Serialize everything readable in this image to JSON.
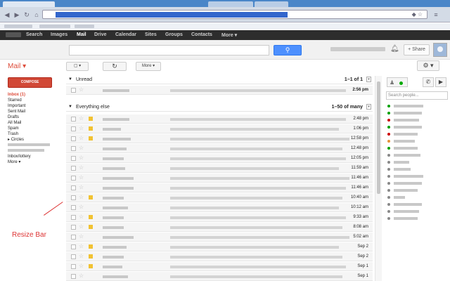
{
  "google_bar": {
    "items": [
      "Search",
      "Images",
      "Mail",
      "Drive",
      "Calendar",
      "Sites",
      "Groups",
      "Contacts",
      "More ▾"
    ]
  },
  "header": {
    "search_placeholder": "",
    "share_label": "+ Share"
  },
  "mail": {
    "title": "Mail ▾",
    "compose_label": "COMPOSE",
    "more_label": "More ▾",
    "refresh_icon": "↻",
    "settings_icon": "⚙ ▾"
  },
  "sidebar": {
    "items": [
      "Inbox (1)",
      "Starred",
      "Important",
      "Sent Mail",
      "Drafts",
      "All Mail",
      "Spam",
      "Trash"
    ],
    "circles_label": "Circles",
    "extra_item": "Inbox/lottery",
    "more_label": "More ▾"
  },
  "annotation": {
    "label": "Resize Bar"
  },
  "sections": {
    "unread": {
      "title": "Unread",
      "paging": "1–1 of 1"
    },
    "everything": {
      "title": "Everything else",
      "paging_prefix": "1–50 of",
      "paging_suffix": "many"
    }
  },
  "unread_rows": [
    {
      "date": "2:56 pm",
      "important": false
    }
  ],
  "rows": [
    {
      "date": "2:48 pm",
      "important": true
    },
    {
      "date": "1:06 pm",
      "important": true
    },
    {
      "date": "12:58 pm",
      "important": true
    },
    {
      "date": "12:48 pm",
      "important": false
    },
    {
      "date": "12:05 pm",
      "important": false
    },
    {
      "date": "11:59 am",
      "important": false
    },
    {
      "date": "11:46 am",
      "important": false
    },
    {
      "date": "11:46 am",
      "important": false
    },
    {
      "date": "10:40 am",
      "important": true
    },
    {
      "date": "10:12 am",
      "important": false
    },
    {
      "date": "9:33 am",
      "important": true
    },
    {
      "date": "8:08 am",
      "important": true
    },
    {
      "date": "5:02 am",
      "important": false
    },
    {
      "date": "Sep 2",
      "important": true
    },
    {
      "date": "Sep 2",
      "important": true
    },
    {
      "date": "Sep 1",
      "important": true
    },
    {
      "date": "Sep 1",
      "important": false
    }
  ],
  "chat": {
    "search_placeholder": "Search people...",
    "contact_status_colors": [
      "#00a000",
      "#00a000",
      "#cc0000",
      "#00a000",
      "#cc0000",
      "#e69138",
      "#00a000",
      "#888888",
      "#888888",
      "#888888",
      "#888888",
      "#888888",
      "#888888",
      "#888888",
      "#888888",
      "#888888",
      "#888888"
    ]
  },
  "colors": {
    "accent_red": "#dd4b39",
    "compose_red": "#d14836",
    "search_blue": "#4d90fe",
    "star_gold": "#f1c232"
  }
}
